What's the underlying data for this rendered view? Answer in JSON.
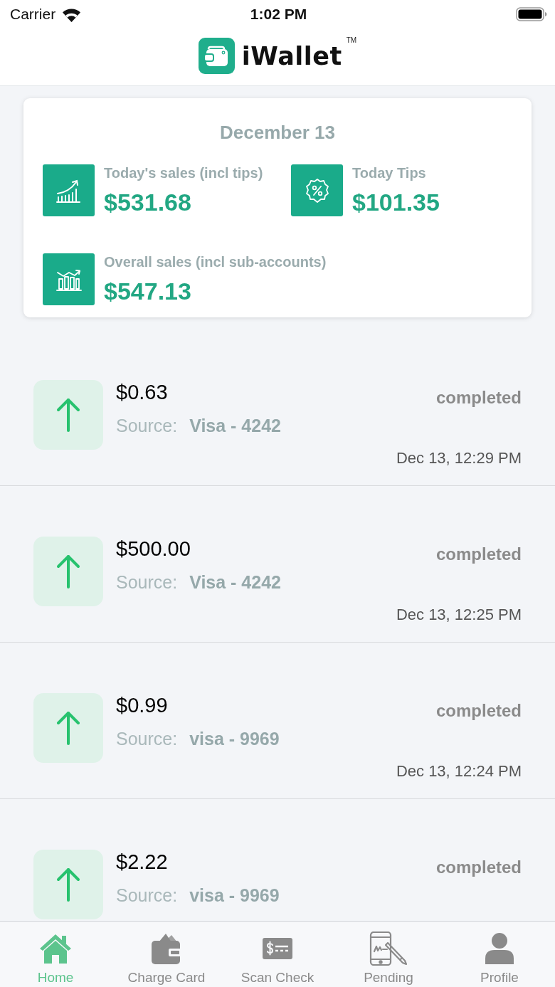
{
  "status_bar": {
    "carrier": "Carrier",
    "time": "1:02 PM"
  },
  "header": {
    "logo_text": "iWallet",
    "trademark": "TM"
  },
  "summary": {
    "title": "December 13",
    "stats": [
      {
        "label": "Today's sales (incl tips)",
        "value": "$531.68"
      },
      {
        "label": "Today Tips",
        "value": "$101.35"
      },
      {
        "label": "Overall sales (incl sub-accounts)",
        "value": "$547.13"
      }
    ]
  },
  "transactions": [
    {
      "amount": "$0.63",
      "source_label": "Source:",
      "source": "Visa - 4242",
      "status": "completed",
      "date": "Dec 13, 12:29 PM"
    },
    {
      "amount": "$500.00",
      "source_label": "Source:",
      "source": "Visa - 4242",
      "status": "completed",
      "date": "Dec 13, 12:25 PM"
    },
    {
      "amount": "$0.99",
      "source_label": "Source:",
      "source": "visa - 9969",
      "status": "completed",
      "date": "Dec 13, 12:24 PM"
    },
    {
      "amount": "$2.22",
      "source_label": "Source:",
      "source": "visa - 9969",
      "status": "completed"
    }
  ],
  "tab_bar": {
    "tabs": [
      {
        "label": "Home",
        "selected": true
      },
      {
        "label": "Charge Card",
        "selected": false
      },
      {
        "label": "Scan Check",
        "selected": false
      },
      {
        "label": "Pending",
        "selected": false
      },
      {
        "label": "Profile",
        "selected": false
      }
    ]
  }
}
